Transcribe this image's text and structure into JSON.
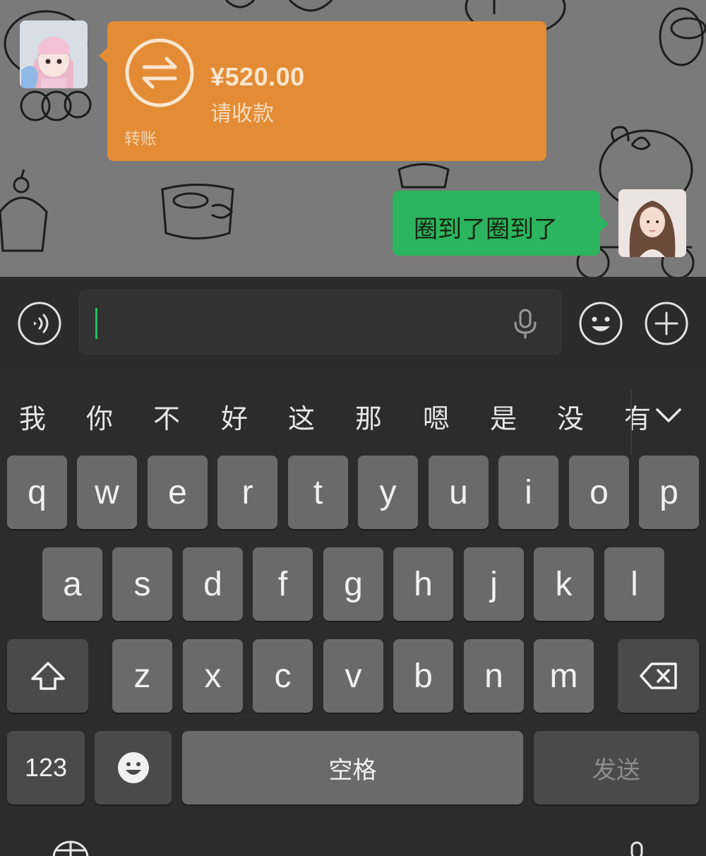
{
  "chat": {
    "transfer": {
      "amount": "¥520.00",
      "status": "请收款",
      "tag": "转账",
      "color": "#e38c35"
    },
    "outgoing_message": "圈到了圈到了",
    "outgoing_color": "#2bb55e",
    "icons": {
      "transfer": "exchange-arrows-icon",
      "left_avatar": "anime-girl-avatar",
      "right_avatar": "long-hair-girl-avatar"
    }
  },
  "input_bar": {
    "value": "",
    "icons": {
      "voice": "voice-waves-icon",
      "mic": "microphone-icon",
      "emoji": "smiley-icon",
      "plus": "plus-circle-icon"
    },
    "caret_color": "#22c160"
  },
  "candidates": {
    "items": [
      "我",
      "你",
      "不",
      "好",
      "这",
      "那",
      "嗯",
      "是",
      "没",
      "有"
    ],
    "collapse_icon": "chevron-down-icon"
  },
  "keyboard": {
    "row1": [
      "q",
      "w",
      "e",
      "r",
      "t",
      "y",
      "u",
      "i",
      "o",
      "p"
    ],
    "row2": [
      "a",
      "s",
      "d",
      "f",
      "g",
      "h",
      "j",
      "k",
      "l"
    ],
    "row3": [
      "z",
      "x",
      "c",
      "v",
      "b",
      "n",
      "m"
    ],
    "shift_icon": "shift-arrow-icon",
    "delete_icon": "backspace-icon",
    "numbers_label": "123",
    "emoji_icon": "emoji-key-icon",
    "space_label": "空格",
    "send_label": "发送",
    "globe_icon": "globe-icon",
    "dictation_icon": "microphone-icon"
  }
}
